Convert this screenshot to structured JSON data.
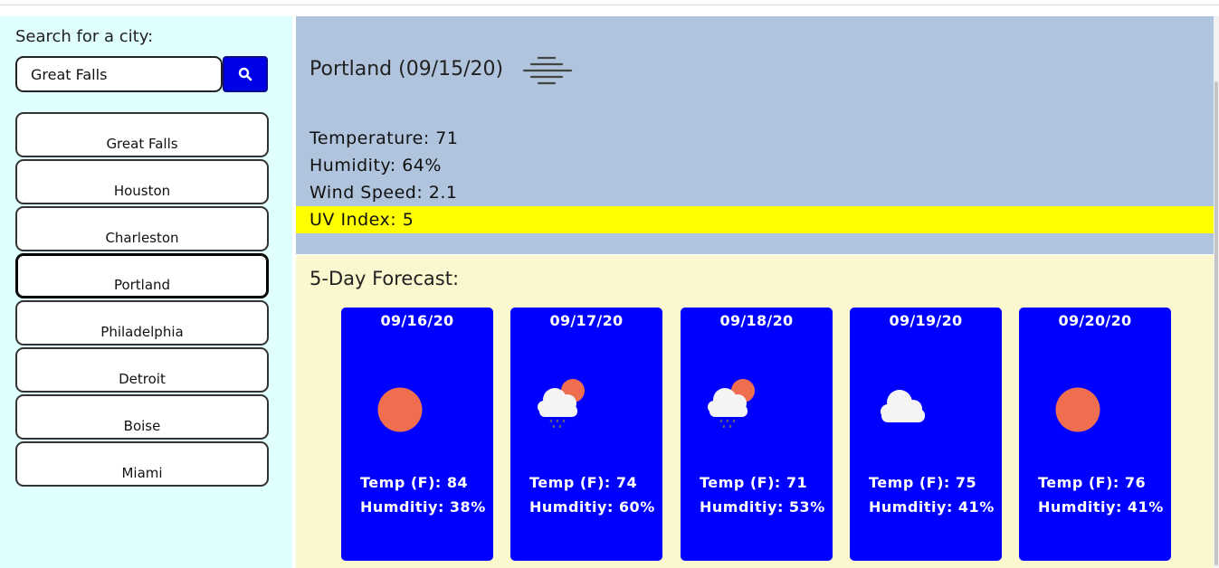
{
  "sidebar": {
    "search_label": "Search for a city:",
    "search_value": "Great Falls",
    "search_button_icon": "search-icon",
    "cities": [
      "Great Falls",
      "Houston",
      "Charleston",
      "Portland",
      "Philadelphia",
      "Detroit",
      "Boise",
      "Miami"
    ],
    "active_city": "Portland"
  },
  "current": {
    "title": "Portland (09/15/20)",
    "icon": "haze-icon",
    "temperature": "Temperature: 71",
    "humidity": "Humidity: 64%",
    "wind": "Wind Speed: 2.1",
    "uv": "UV Index: 5",
    "uv_color": "#ffff00",
    "panel_color": "#b0c4de"
  },
  "forecast": {
    "title": "5-Day Forecast:",
    "card_color": "#0000ff",
    "days": [
      {
        "date": "09/16/20",
        "icon": "sun-icon",
        "temp": "Temp (F): 84",
        "humidity": "Humditiy: 38%"
      },
      {
        "date": "09/17/20",
        "icon": "rain-cloud-sun-icon",
        "temp": "Temp (F): 74",
        "humidity": "Humditiy: 60%"
      },
      {
        "date": "09/18/20",
        "icon": "rain-cloud-sun-icon",
        "temp": "Temp (F): 71",
        "humidity": "Humditiy: 53%"
      },
      {
        "date": "09/19/20",
        "icon": "cloud-icon",
        "temp": "Temp (F): 75",
        "humidity": "Humditiy: 41%"
      },
      {
        "date": "09/20/20",
        "icon": "sun-icon",
        "temp": "Temp (F): 76",
        "humidity": "Humditiy: 41%"
      }
    ]
  }
}
